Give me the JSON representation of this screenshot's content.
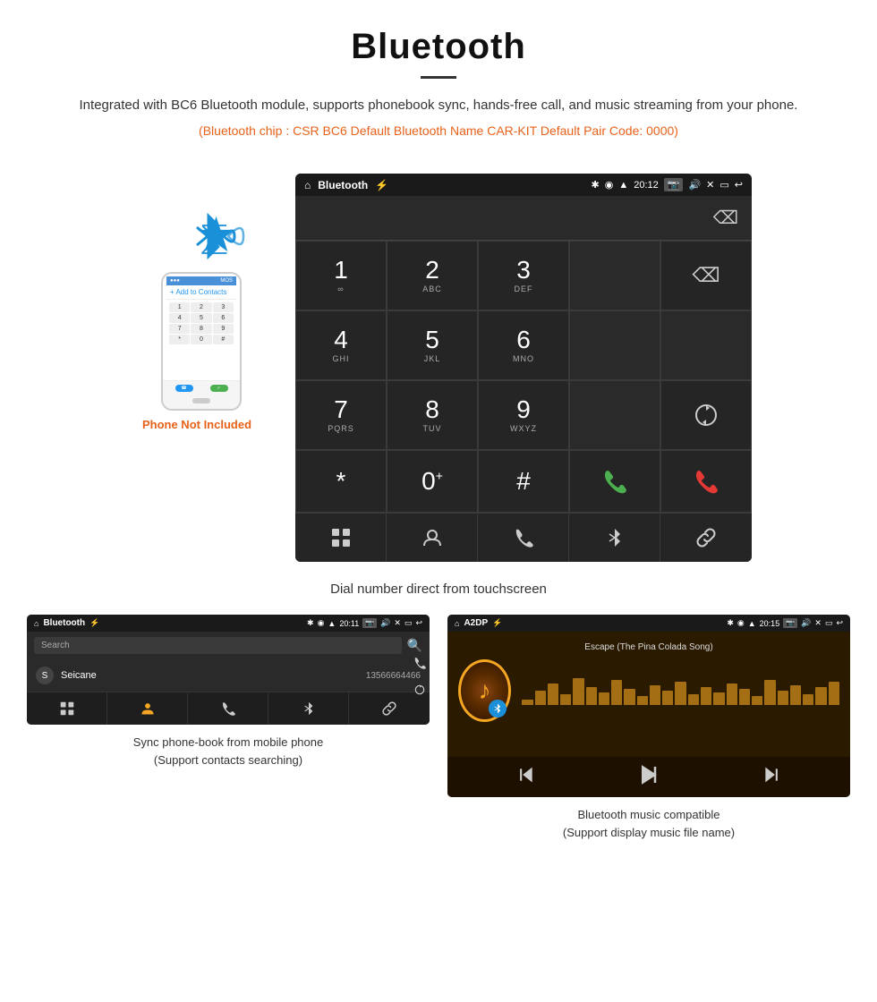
{
  "header": {
    "title": "Bluetooth",
    "description": "Integrated with BC6 Bluetooth module, supports phonebook sync, hands-free call, and music streaming from your phone.",
    "specs": "(Bluetooth chip : CSR BC6    Default Bluetooth Name CAR-KIT    Default Pair Code: 0000)"
  },
  "phone_illustration": {
    "not_included_label": "Phone Not Included"
  },
  "dialpad_screen": {
    "statusbar": {
      "app_name": "Bluetooth",
      "time": "20:12"
    },
    "keys": [
      {
        "number": "1",
        "letters": "∞"
      },
      {
        "number": "2",
        "letters": "ABC"
      },
      {
        "number": "3",
        "letters": "DEF"
      },
      {
        "number": "",
        "letters": ""
      },
      {
        "number": "",
        "letters": ""
      },
      {
        "number": "4",
        "letters": "GHI"
      },
      {
        "number": "5",
        "letters": "JKL"
      },
      {
        "number": "6",
        "letters": "MNO"
      },
      {
        "number": "",
        "letters": ""
      },
      {
        "number": "",
        "letters": ""
      },
      {
        "number": "7",
        "letters": "PQRS"
      },
      {
        "number": "8",
        "letters": "TUV"
      },
      {
        "number": "9",
        "letters": "WXYZ"
      },
      {
        "number": "",
        "letters": ""
      },
      {
        "number": "",
        "letters": ""
      },
      {
        "number": "*",
        "letters": ""
      },
      {
        "number": "0",
        "letters": "+"
      },
      {
        "number": "#",
        "letters": ""
      },
      {
        "number": "",
        "letters": ""
      },
      {
        "number": "",
        "letters": ""
      }
    ],
    "caption": "Dial number direct from touchscreen"
  },
  "phonebook_screen": {
    "statusbar": {
      "app_name": "Bluetooth",
      "time": "20:11"
    },
    "search_placeholder": "Search",
    "contact": {
      "initial": "S",
      "name": "Seicane",
      "number": "13566664466"
    },
    "caption_line1": "Sync phone-book from mobile phone",
    "caption_line2": "(Support contacts searching)"
  },
  "music_screen": {
    "statusbar": {
      "app_name": "A2DP",
      "time": "20:15"
    },
    "song_title": "Escape (The Pina Colada Song)",
    "eq_bars": [
      3,
      8,
      12,
      6,
      15,
      10,
      7,
      14,
      9,
      5,
      11,
      8,
      13,
      6,
      10,
      7,
      12,
      9,
      5,
      14,
      8,
      11,
      6,
      10,
      13
    ],
    "caption_line1": "Bluetooth music compatible",
    "caption_line2": "(Support display music file name)"
  }
}
